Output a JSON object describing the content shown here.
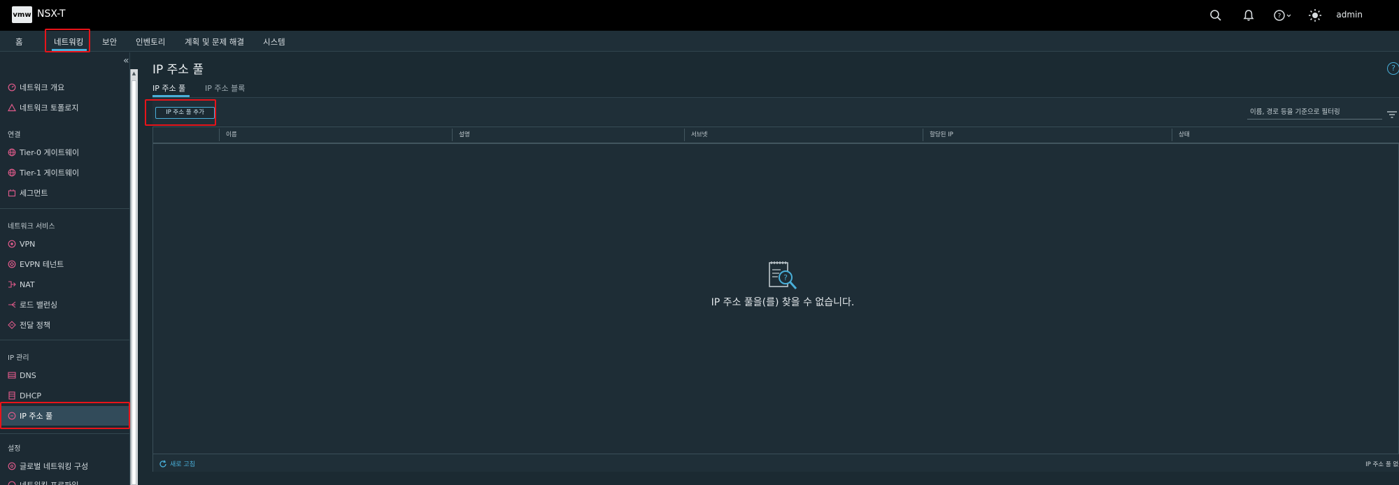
{
  "header": {
    "logo_text": "vmw",
    "app_title": "NSX-T",
    "user": "admin",
    "icons": [
      "search-icon",
      "bell-icon",
      "help-icon",
      "sun-icon"
    ]
  },
  "nav": {
    "items": [
      {
        "label": "홈"
      },
      {
        "label": "네트워킹",
        "active": true
      },
      {
        "label": "보안"
      },
      {
        "label": "인벤토리"
      },
      {
        "label": "계획 및 문제 해결"
      },
      {
        "label": "시스템"
      }
    ]
  },
  "sidebar": {
    "collapse_icon": "«",
    "top_items": [
      {
        "label": "네트워크 개요",
        "icon": "gauge-icon"
      },
      {
        "label": "네트워크 토폴로지",
        "icon": "topology-icon"
      }
    ],
    "sections": [
      {
        "title": "연결",
        "items": [
          {
            "label": "Tier-0 게이트웨이",
            "icon": "globe-icon"
          },
          {
            "label": "Tier-1 게이트웨이",
            "icon": "globe-icon"
          },
          {
            "label": "세그먼트",
            "icon": "segment-icon"
          }
        ]
      },
      {
        "title": "네트워크 서비스",
        "items": [
          {
            "label": "VPN",
            "icon": "vpn-icon"
          },
          {
            "label": "EVPN 테넌트",
            "icon": "evpn-icon"
          },
          {
            "label": "NAT",
            "icon": "nat-icon"
          },
          {
            "label": "로드 밸런싱",
            "icon": "load-balancer-icon"
          },
          {
            "label": "전달 정책",
            "icon": "forwarding-icon"
          }
        ]
      },
      {
        "title": "IP 관리",
        "items": [
          {
            "label": "DNS",
            "icon": "dns-icon"
          },
          {
            "label": "DHCP",
            "icon": "dhcp-icon"
          },
          {
            "label": "IP 주소 풀",
            "icon": "ip-pool-icon",
            "selected": true
          }
        ]
      },
      {
        "title": "설정",
        "items": [
          {
            "label": "글로벌 네트워킹 구성",
            "icon": "global-config-icon"
          },
          {
            "label": "네트워킹 프로파일",
            "icon": "profile-icon"
          }
        ]
      }
    ]
  },
  "main": {
    "title": "IP 주소 풀",
    "help_icon": "?",
    "tabs": [
      {
        "label": "IP 주소 풀",
        "active": true
      },
      {
        "label": "IP 주소 블록",
        "active": false
      }
    ],
    "add_button": "IP 주소 풀 추가",
    "filter_placeholder": "이름, 경로 등을 기준으로 필터링",
    "columns": [
      "이름",
      "설명",
      "서브넷",
      "할당된 IP",
      "상태"
    ],
    "empty_text": "IP 주소 풀을(를) 찾을 수 없습니다.",
    "refresh_label": "새로 고침",
    "footer_count": "IP 주소 풀 없음"
  },
  "colors": {
    "accent": "#49afd9",
    "highlight": "#e8141a",
    "header_bg": "#000000",
    "content_bg": "#1b2a32",
    "icon_pink": "#e05b8b"
  }
}
